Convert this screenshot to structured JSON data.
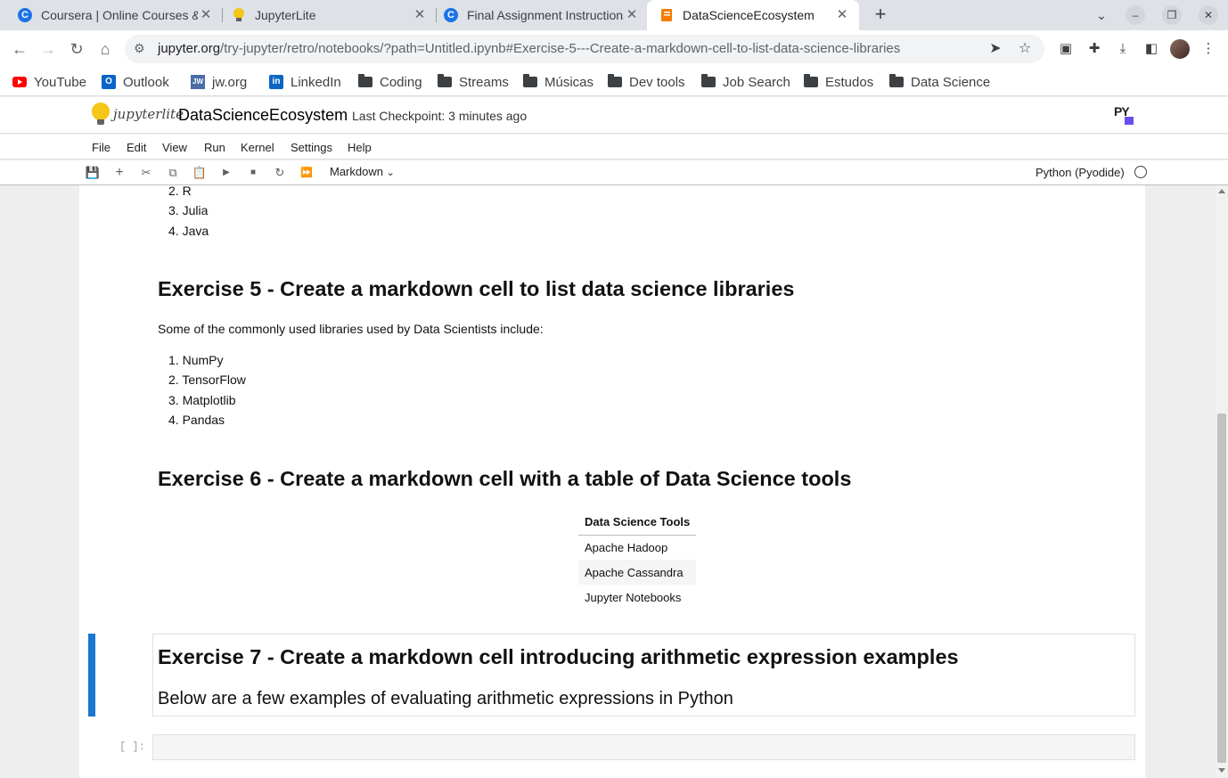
{
  "browser": {
    "tabs": [
      {
        "title": "Coursera | Online Courses & Credentials",
        "icon": "coursera-icon"
      },
      {
        "title": "JupyterLite",
        "icon": "jupyterlite-icon"
      },
      {
        "title": "Final Assignment Instructions",
        "icon": "coursera-icon"
      },
      {
        "title": "DataScienceEcosystem",
        "icon": "notebook-icon",
        "active": true
      }
    ],
    "url_host": "jupyter.org",
    "url_path": "/try-jupyter/retro/notebooks/?path=Untitled.ipynb#Exercise-5---Create-a-markdown-cell-to-list-data-science-libraries",
    "bookmarks": [
      {
        "label": "YouTube",
        "icon": "youtube-icon"
      },
      {
        "label": "Outlook",
        "icon": "outlook-icon"
      },
      {
        "label": "jw.org",
        "icon": "jw-icon"
      },
      {
        "label": "LinkedIn",
        "icon": "linkedin-icon"
      },
      {
        "label": "Coding",
        "icon": "folder-icon"
      },
      {
        "label": "Streams",
        "icon": "folder-icon"
      },
      {
        "label": "Músicas",
        "icon": "folder-icon"
      },
      {
        "label": "Dev tools",
        "icon": "folder-icon"
      },
      {
        "label": "Job Search",
        "icon": "folder-icon"
      },
      {
        "label": "Estudos",
        "icon": "folder-icon"
      },
      {
        "label": "Data Science",
        "icon": "folder-icon"
      }
    ]
  },
  "jupyter": {
    "logo_text": "jupyterlite",
    "notebook_name": "DataScienceEcosystem",
    "checkpoint": "Last Checkpoint: 3 minutes ago",
    "menu": [
      "File",
      "Edit",
      "View",
      "Run",
      "Kernel",
      "Settings",
      "Help"
    ],
    "cell_type": "Markdown",
    "kernel": "Python (Pyodide)",
    "accent_color": "#1976d2"
  },
  "notebook": {
    "languages_tail": [
      {
        "num": "2.",
        "text": "R"
      },
      {
        "num": "3.",
        "text": "Julia"
      },
      {
        "num": "4.",
        "text": "Java"
      }
    ],
    "ex5_title": "Exercise 5 - Create a markdown cell to list data science libraries",
    "ex5_intro": "Some of the commonly used libraries used by Data Scientists include:",
    "libraries": [
      {
        "num": "1.",
        "text": "NumPy"
      },
      {
        "num": "2.",
        "text": "TensorFlow"
      },
      {
        "num": "3.",
        "text": "Matplotlib"
      },
      {
        "num": "4.",
        "text": "Pandas"
      }
    ],
    "ex6_title": "Exercise 6 - Create a markdown cell with a table of Data Science tools",
    "table_header": "Data Science Tools",
    "tools": [
      "Apache Hadoop",
      "Apache Cassandra",
      "Jupyter Notebooks"
    ],
    "ex7_title": "Exercise 7 - Create a markdown cell introducing arithmetic expression examples",
    "ex7_text": "Below are a few examples of evaluating arithmetic expressions in Python",
    "empty_prompt": "[ ]:"
  }
}
